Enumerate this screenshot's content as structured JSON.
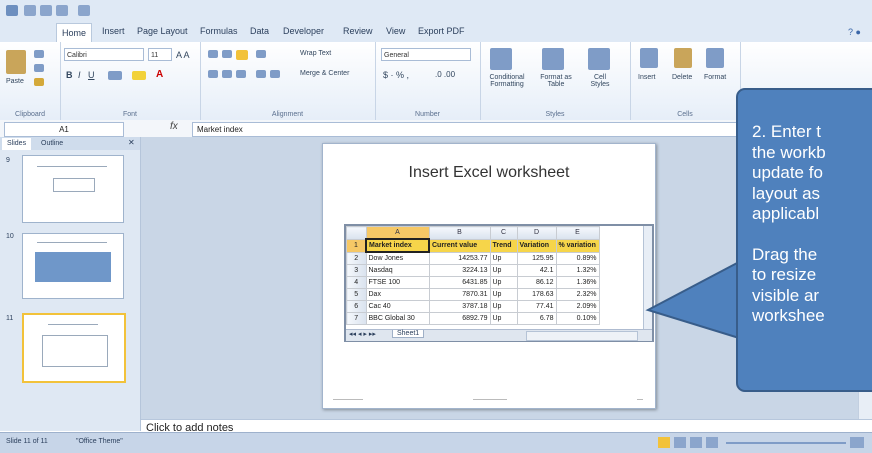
{
  "ribbon": {
    "tabs": [
      "Home",
      "Insert",
      "Page Layout",
      "Formulas",
      "Data",
      "Developer",
      "Review",
      "View",
      "Export PDF"
    ],
    "groups": [
      "Clipboard",
      "Font",
      "Alignment",
      "Number",
      "Styles",
      "Cells"
    ],
    "font_name": "Calibri",
    "font_size": "11",
    "number_format": "General",
    "buttons": {
      "paste": "Paste",
      "wrap_text": "Wrap Text",
      "merge_center": "Merge & Center",
      "conditional_formatting": "Conditional Formatting",
      "format_as_table": "Format as Table",
      "cell_styles": "Cell Styles",
      "insert": "Insert",
      "delete": "Delete",
      "format": "Format"
    }
  },
  "formula_bar": {
    "name_box": "A1",
    "fx": "fx",
    "value": "Market index"
  },
  "left_pane": {
    "tabs": [
      "Slides",
      "Outline"
    ],
    "slide_numbers": [
      "9",
      "10",
      "11"
    ]
  },
  "slide": {
    "title": "Insert Excel worksheet"
  },
  "worksheet": {
    "columns": [
      "A",
      "B",
      "C",
      "D",
      "E"
    ],
    "header": [
      "Market index",
      "Current value",
      "Trend",
      "Variation",
      "% variation"
    ],
    "rows": [
      [
        "Dow Jones",
        "14253.77",
        "Up",
        "125.95",
        "0.89%"
      ],
      [
        "Nasdaq",
        "3224.13",
        "Up",
        "42.1",
        "1.32%"
      ],
      [
        "FTSE 100",
        "6431.85",
        "Up",
        "86.12",
        "1.36%"
      ],
      [
        "Dax",
        "7870.31",
        "Up",
        "178.63",
        "2.32%"
      ],
      [
        "Cac 40",
        "3787.18",
        "Up",
        "77.41",
        "2.09%"
      ],
      [
        "BBC Global 30",
        "6892.79",
        "Up",
        "6.78",
        "0.10%"
      ]
    ],
    "sheet_tab": "Sheet1"
  },
  "notes": {
    "placeholder": "Click to add notes"
  },
  "status_bar": {
    "slide_info": "Slide 11 of 11",
    "theme": "\"Office Theme\""
  },
  "callout": {
    "text_1": "2. Enter t\nthe workb\nupdate fo\nlayout as\napplicabl",
    "text_2": "Drag the\nto resize\nvisible ar\nworkshee",
    "fill_color": "#4f81bd"
  },
  "colors": {
    "header_fill": "#f6d54a",
    "selected_header": "#f6c866",
    "ribbon_bg": "#dfe9f5"
  }
}
